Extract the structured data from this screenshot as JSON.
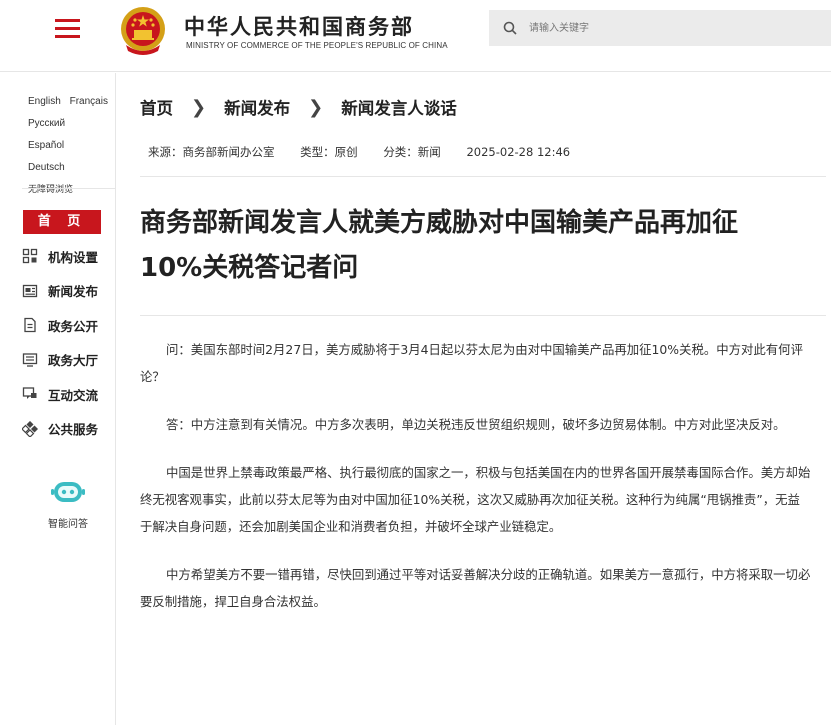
{
  "header": {
    "site_title": "中华人民共和国商务部",
    "site_subtitle": "MINISTRY OF COMMERCE OF THE PEOPLE'S REPUBLIC OF CHINA",
    "search_placeholder": "请输入关键字"
  },
  "sidebar": {
    "languages": [
      "English",
      "Français",
      "Русский",
      "Español",
      "Deutsch"
    ],
    "barrier_free": "无障碍浏览",
    "home": "首 页",
    "nav": [
      {
        "label": "机构设置",
        "icon": "org-structure-icon"
      },
      {
        "label": "新闻发布",
        "icon": "news-icon"
      },
      {
        "label": "政务公开",
        "icon": "document-icon"
      },
      {
        "label": "政务大厅",
        "icon": "service-hall-icon"
      },
      {
        "label": "互动交流",
        "icon": "interaction-icon"
      },
      {
        "label": "公共服务",
        "icon": "public-service-icon"
      }
    ],
    "assistant_label": "智能问答"
  },
  "breadcrumb": [
    "首页",
    "新闻发布",
    "新闻发言人谈话"
  ],
  "meta": {
    "source": "来源：商务部新闻办公室",
    "type": "类型：原创",
    "category": "分类：新闻",
    "datetime": "2025-02-28 12:46"
  },
  "article": {
    "title": "商务部新闻发言人就美方威胁对中国输美产品再加征10%关税答记者问",
    "paragraphs": [
      "问：美国东部时间2月27日，美方威胁将于3月4日起以芬太尼为由对中国输美产品再加征10%关税。中方对此有何评论？",
      "答：中方注意到有关情况。中方多次表明，单边关税违反世贸组织规则，破坏多边贸易体制。中方对此坚决反对。",
      "中国是世界上禁毒政策最严格、执行最彻底的国家之一，积极与包括美国在内的世界各国开展禁毒国际合作。美方却始终无视客观事实，此前以芬太尼等为由对中国加征10%关税，这次又威胁再次加征关税。这种行为纯属“甩锅推责”，无益于解决自身问题，还会加剧美国企业和消费者负担，并破坏全球产业链稳定。",
      "中方希望美方不要一错再错，尽快回到通过平等对话妥善解决分歧的正确轨道。如果美方一意孤行，中方将采取一切必要反制措施，捍卫自身合法权益。"
    ]
  },
  "colors": {
    "accent_red": "#c8161d",
    "emblem_gold": "#f2c230"
  }
}
